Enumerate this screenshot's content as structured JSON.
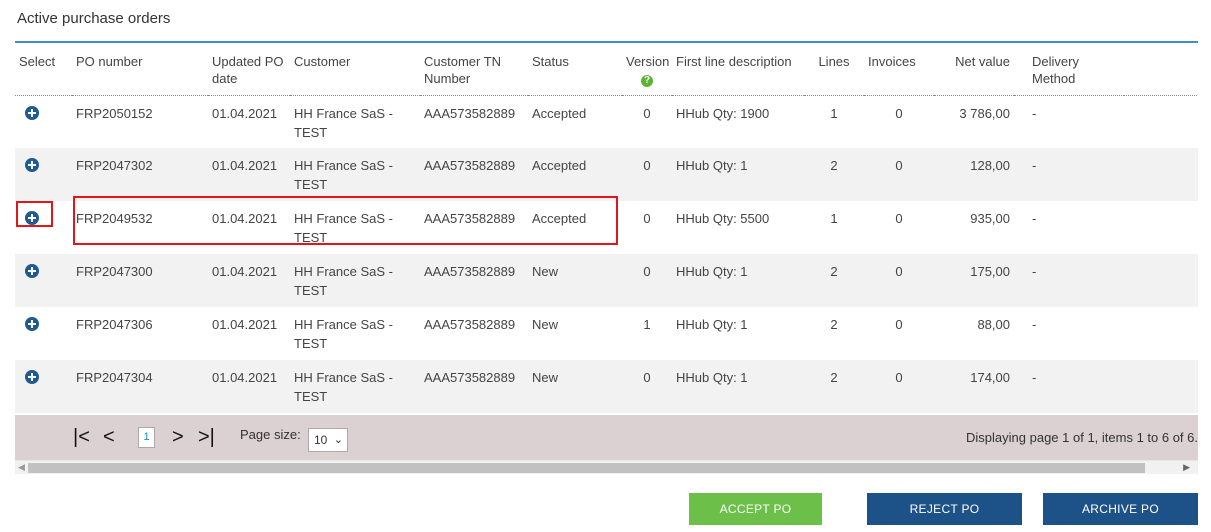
{
  "panel": {
    "title": "Active purchase orders"
  },
  "columns": {
    "select": "Select",
    "po_number": "PO number",
    "updated": "Updated PO date",
    "customer": "Customer",
    "customer_tn": "Customer TN Number",
    "status": "Status",
    "version": "Version",
    "version_help": "?",
    "first_line": "First line description",
    "lines": "Lines",
    "invoices": "Invoices",
    "net_value": "Net value",
    "delivery": "Delivery Method"
  },
  "rows": [
    {
      "po": "FRP2050152",
      "date": "01.04.2021",
      "customer": "HH France SaS - TEST",
      "tn": "AAA573582889",
      "status": "Accepted",
      "version": "0",
      "desc": "HHub Qty: 1900",
      "lines": "1",
      "invoices": "0",
      "net": "3 786,00",
      "delivery": "-",
      "action": "Preview"
    },
    {
      "po": "FRP2047302",
      "date": "01.04.2021",
      "customer": "HH France SaS - TEST",
      "tn": "AAA573582889",
      "status": "Accepted",
      "version": "0",
      "desc": "HHub Qty: 1",
      "lines": "2",
      "invoices": "0",
      "net": "128,00",
      "delivery": "-",
      "action": "Preview"
    },
    {
      "po": "FRP2049532",
      "date": "01.04.2021",
      "customer": "HH France SaS - TEST",
      "tn": "AAA573582889",
      "status": "Accepted",
      "version": "0",
      "desc": "HHub Qty: 5500",
      "lines": "1",
      "invoices": "0",
      "net": "935,00",
      "delivery": "-",
      "action": "Preview"
    },
    {
      "po": "FRP2047300",
      "date": "01.04.2021",
      "customer": "HH France SaS - TEST",
      "tn": "AAA573582889",
      "status": "New",
      "version": "0",
      "desc": "HHub Qty: 1",
      "lines": "2",
      "invoices": "0",
      "net": "175,00",
      "delivery": "-",
      "action": "Preview"
    },
    {
      "po": "FRP2047306",
      "date": "01.04.2021",
      "customer": "HH France SaS - TEST",
      "tn": "AAA573582889",
      "status": "New",
      "version": "1",
      "desc": "HHub Qty: 1",
      "lines": "2",
      "invoices": "0",
      "net": "88,00",
      "delivery": "-",
      "action": "Preview"
    },
    {
      "po": "FRP2047304",
      "date": "01.04.2021",
      "customer": "HH France SaS - TEST",
      "tn": "AAA573582889",
      "status": "New",
      "version": "0",
      "desc": "HHub Qty: 1",
      "lines": "2",
      "invoices": "0",
      "net": "174,00",
      "delivery": "-",
      "action": "Preview"
    }
  ],
  "pager": {
    "first": "|<",
    "prev": "<",
    "current_page": "1",
    "next": ">",
    "last": ">|",
    "page_size_label": "Page size:",
    "page_size_value": "10",
    "info": "Displaying page 1 of 1, items 1 to 6 of 6."
  },
  "actions": {
    "accept": "ACCEPT PO",
    "reject": "REJECT PO",
    "archive": "ARCHIVE PO"
  },
  "colors": {
    "accent_blue": "#3d8fc9",
    "link_blue": "#1a8ad4",
    "accept_green": "#6cc04a",
    "dark_blue": "#1d5289",
    "highlight_red": "#e0161a",
    "pager_bg": "#dbd1d2"
  },
  "icons": {
    "row_expand": "plus-circle-icon",
    "version_help": "question-circle-icon"
  }
}
